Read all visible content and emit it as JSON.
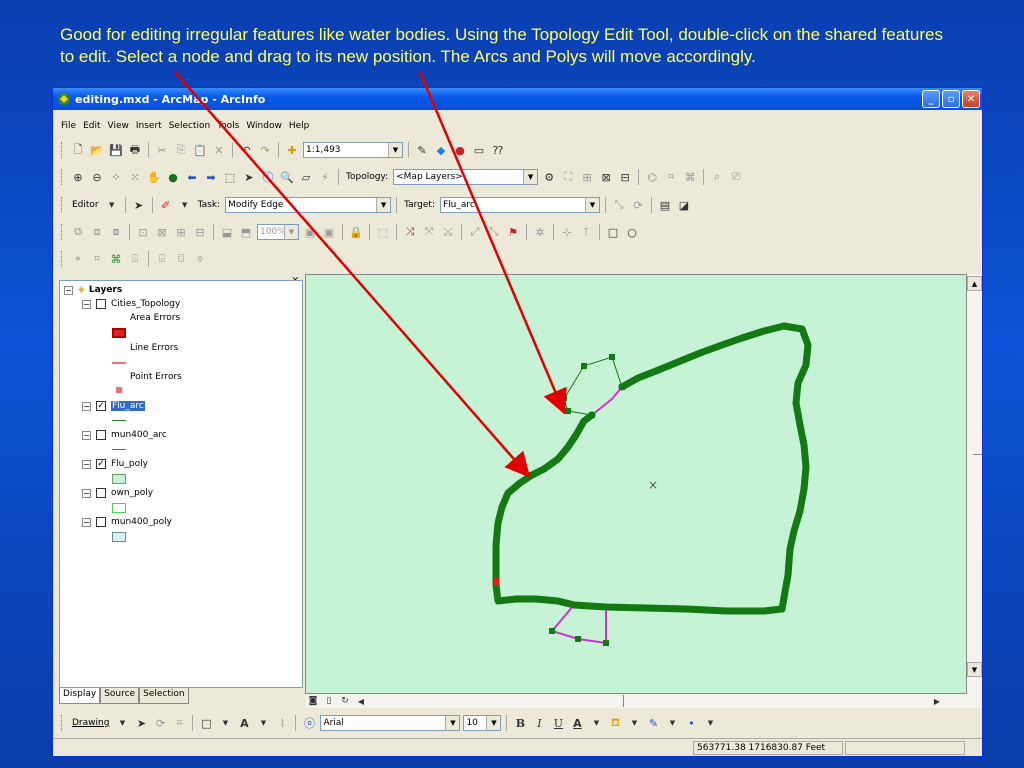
{
  "caption": "Good for editing irregular features like water bodies. Using the Topology Edit Tool, double-click on the shared features to edit. Select a node and drag to its new position. The Arcs and Polys will move accordingly.",
  "window": {
    "title": "editing.mxd - ArcMap - ArcInfo"
  },
  "menu": {
    "items": [
      "File",
      "Edit",
      "View",
      "Insert",
      "Selection",
      "Tools",
      "Window",
      "Help"
    ]
  },
  "standard_toolbar": {
    "scale": "1:1,493"
  },
  "topology_toolbar": {
    "label": "Topology:",
    "value": "<Map Layers>"
  },
  "editor_toolbar": {
    "editor_label": "Editor",
    "task_label": "Task:",
    "task_value": "Modify Edge",
    "target_label": "Target:",
    "target_value": "Flu_arc"
  },
  "extra_toolbar": {
    "zoom_value": "100%"
  },
  "toc": {
    "root_label": "Layers",
    "layers": [
      {
        "name": "Cities_Topology",
        "checked": false
      },
      {
        "name": "Flu_arc",
        "checked": true
      },
      {
        "name": "mun400_arc",
        "checked": false
      },
      {
        "name": "Flu_poly",
        "checked": true
      },
      {
        "name": "own_poly",
        "checked": false
      },
      {
        "name": "mun400_poly",
        "checked": false
      }
    ],
    "legend": {
      "area_errors": "Area Errors",
      "line_errors": "Line Errors",
      "point_errors": "Point Errors"
    },
    "tabs": [
      "Display",
      "Source",
      "Selection"
    ]
  },
  "drawing_toolbar": {
    "drawing_label": "Drawing",
    "font_name": "Arial",
    "font_size": "10",
    "bold": "B",
    "italic": "I",
    "underline": "U",
    "font_color_glyph": "A"
  },
  "status": {
    "coordinates": "563771.38  1716830.87 Feet"
  },
  "colors": {
    "map_background": "#c6f2d6",
    "arc_color": "#137a13",
    "edit_segment": "#cc33cc",
    "arrow_color": "#e00000",
    "caption_color": "#ffff66"
  }
}
